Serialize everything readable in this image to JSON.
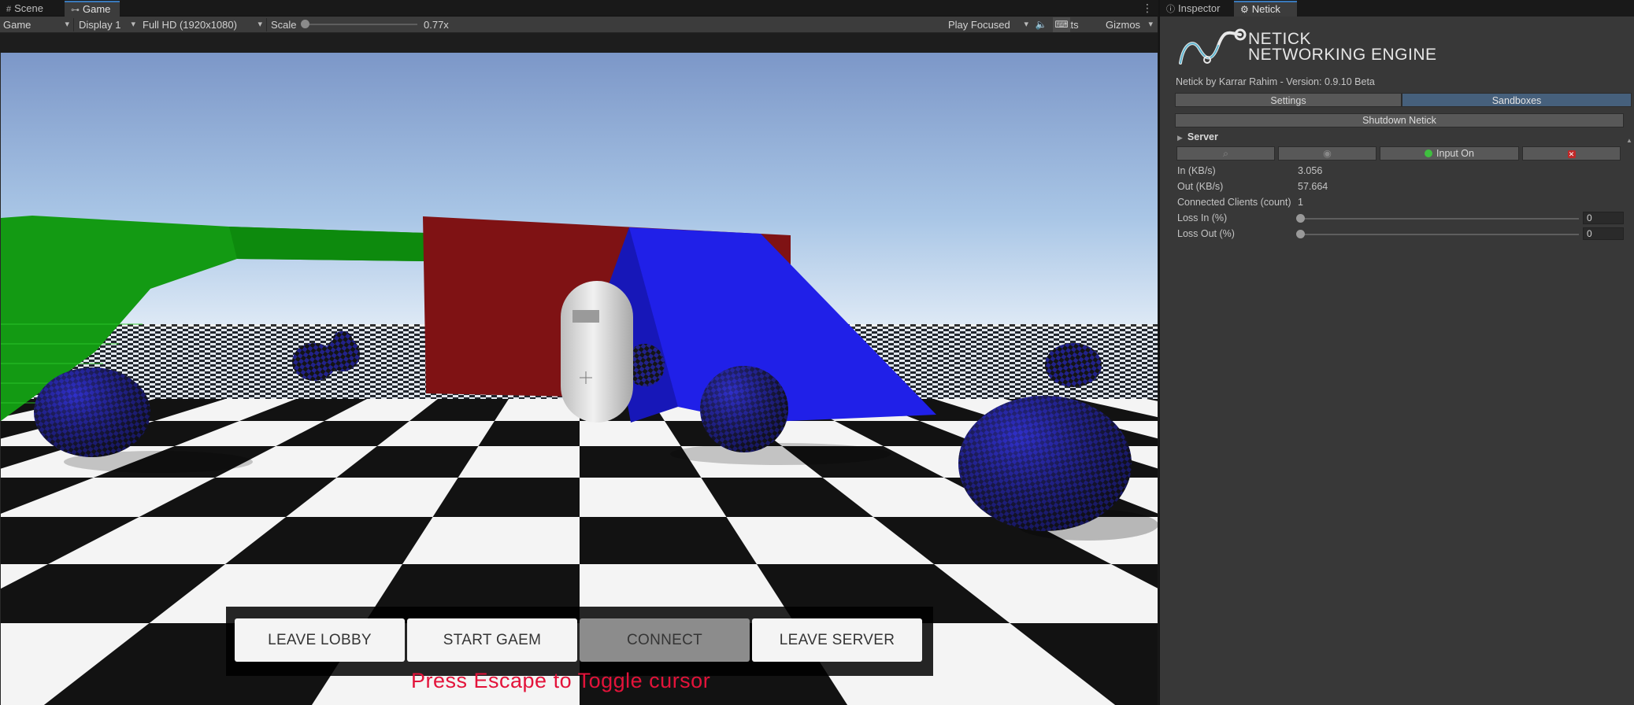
{
  "left_tabs": [
    {
      "label": "Scene",
      "icon": "hash-icon"
    },
    {
      "label": "Game",
      "icon": "gamepad-icon"
    }
  ],
  "toolbar": {
    "view_mode": "Game",
    "display": "Display 1",
    "resolution": "Full HD (1920x1080)",
    "scale_label": "Scale",
    "scale_value": "0.77x",
    "scale_level": 0.0,
    "play_mode": "Play Focused",
    "stats": "Stats",
    "gizmos": "Gizmos"
  },
  "game_ui": {
    "buttons": [
      {
        "label": "LEAVE LOBBY",
        "enabled": true
      },
      {
        "label": "START GAEM",
        "enabled": true
      },
      {
        "label": "CONNECT",
        "enabled": false
      },
      {
        "label": "LEAVE SERVER",
        "enabled": true
      }
    ],
    "hint": "Press Escape to Toggle cursor"
  },
  "right_tabs": [
    {
      "label": "Inspector",
      "icon": "info-icon"
    },
    {
      "label": "Netick",
      "icon": "gear-icon"
    }
  ],
  "netick": {
    "logo_line1": "NETICK",
    "logo_line2": "NETWORKING ENGINE",
    "version": "Netick by Karrar Rahim - Version: 0.9.10 Beta",
    "tabs": [
      "Settings",
      "Sandboxes"
    ],
    "shutdown": "Shutdown Netick",
    "server": {
      "label": "Server",
      "input_on": "Input On",
      "rows": [
        {
          "label": "In (KB/s)",
          "value": "3.056"
        },
        {
          "label": "Out (KB/s)",
          "value": "57.664"
        },
        {
          "label": "Connected Clients (count)",
          "value": "1"
        }
      ],
      "loss_in_label": "Loss In (%)",
      "loss_in_value": "0",
      "loss_out_label": "Loss Out (%)",
      "loss_out_value": "0"
    }
  },
  "colors": {
    "accent": "#3a79bb",
    "selected_tab": "#46607c",
    "hint": "#e3133a",
    "sky": "#7fa0cf",
    "wall_red": "#7f1214",
    "ramp_blue": "#2222e6",
    "platform_green": "#139a13"
  }
}
